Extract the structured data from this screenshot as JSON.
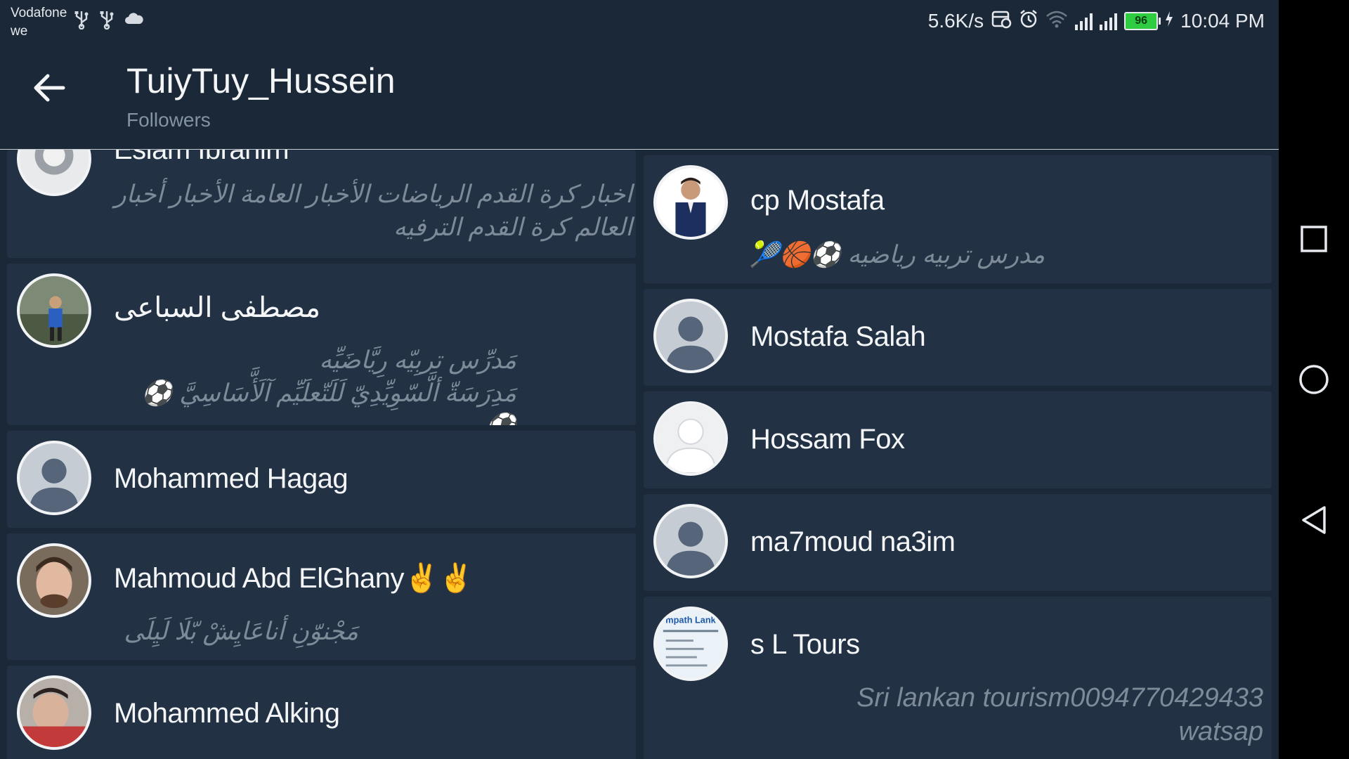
{
  "status_bar": {
    "carrier_line1": "Vodafone",
    "carrier_line2": "we",
    "net_speed": "5.6K/s",
    "battery": "96",
    "time": "10:04 PM",
    "icons": [
      "usb-icon",
      "usb-icon",
      "cloud-icon",
      "data-saver-icon",
      "alarm-icon",
      "wifi-icon",
      "signal-icon",
      "signal-icon",
      "battery-icon",
      "charging-icon"
    ]
  },
  "app_bar": {
    "back_icon": "arrow-left-icon",
    "title": "TuiyTuy_Hussein",
    "subtitle": "Followers"
  },
  "followers_left": [
    {
      "name": "Eslam Ibrahim",
      "bio": "اخبار كرة القدم الرياضات الأخبار العامة الأخبار أخبار العالم كرة القدم الترفيه"
    },
    {
      "name": "مصطفى السباعى",
      "bio_line1": "مَدرِّس تربِيّه رِيَّاضَيِّه",
      "bio_line2": "مَدِرَسَةّ ألَّسّوِيِّدِيّ لَلَتّعلَيِّم آلَأَّسَاسِيَّ ⚽⚽"
    },
    {
      "name": "Mohammed Hagag"
    },
    {
      "name": "Mahmoud Abd ElGhany✌✌",
      "bio": "مَجْنوّنِ أناعَايِشْ بّلَا لَيِلَى"
    },
    {
      "name": "Mohammed Alking"
    }
  ],
  "followers_right": [
    {
      "name": "cp Mostafa",
      "bio": "مدرس تربيه رياضيه ⚽🏀🎾"
    },
    {
      "name": "Mostafa Salah"
    },
    {
      "name": "Hossam Fox"
    },
    {
      "name": "ma7moud na3im"
    },
    {
      "name": "s L Tours",
      "avatar_text": "mpath Lank",
      "bio_line1": "Sri lankan tourism0094770429433",
      "bio_line2": "watsap"
    }
  ],
  "nav_bar": {
    "icons": [
      "recents-square-icon",
      "home-circle-icon",
      "back-triangle-icon"
    ]
  },
  "colors": {
    "background": "#1b2837",
    "card": "#223244",
    "text_primary": "#f4f6f8",
    "text_secondary": "#7d8a98",
    "battery_green": "#2ecc40"
  }
}
